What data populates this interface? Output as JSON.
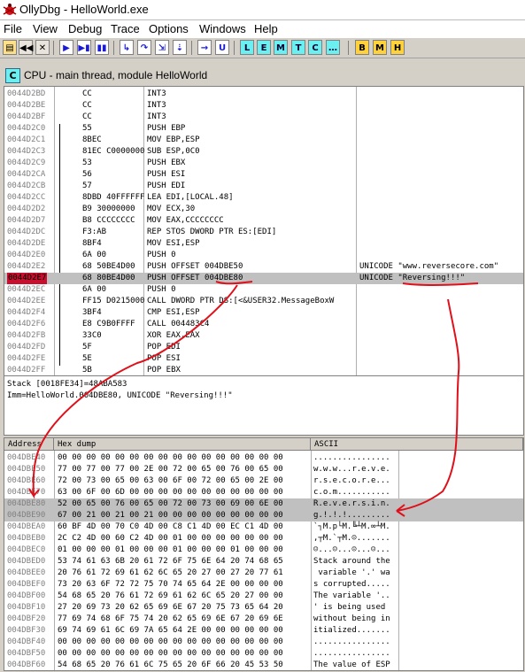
{
  "window": {
    "title": "OllyDbg - HelloWorld.exe"
  },
  "menu": [
    "File",
    "View",
    "Debug",
    "Trace",
    "Options",
    "Windows",
    "Help"
  ],
  "toolbar": {
    "buttons": [
      {
        "name": "open",
        "label": "▤"
      },
      {
        "name": "restart",
        "label": "◀◀"
      },
      {
        "name": "close",
        "label": "✕"
      },
      {
        "name": "run",
        "label": "▶"
      },
      {
        "name": "run-thread",
        "label": "▶▮"
      },
      {
        "name": "pause",
        "label": "▮▮"
      },
      {
        "name": "step-into",
        "label": "↳"
      },
      {
        "name": "step-over",
        "label": "↷"
      },
      {
        "name": "animate-into",
        "label": "⇲"
      },
      {
        "name": "animate-over",
        "label": "⇣"
      },
      {
        "name": "execute-till-return",
        "label": "→"
      },
      {
        "name": "go-to",
        "label": "U"
      },
      {
        "name": "log",
        "label": "L"
      },
      {
        "name": "executable-modules",
        "label": "E"
      },
      {
        "name": "memory-map",
        "label": "M"
      },
      {
        "name": "threads",
        "label": "T"
      },
      {
        "name": "cpu",
        "label": "C"
      },
      {
        "name": "more",
        "label": "…"
      },
      {
        "name": "breakpoints",
        "label": "B"
      },
      {
        "name": "memory-breakpoints",
        "label": "M"
      },
      {
        "name": "hardware-breakpoints",
        "label": "H"
      }
    ]
  },
  "cpu_title": "CPU - main thread, module HelloWorld",
  "disasm": [
    {
      "addr": "0044D2BD",
      "hex": "CC",
      "asm": "INT3",
      "comment": ""
    },
    {
      "addr": "0044D2BE",
      "hex": "CC",
      "asm": "INT3",
      "comment": ""
    },
    {
      "addr": "0044D2BF",
      "hex": "CC",
      "asm": "INT3",
      "comment": ""
    },
    {
      "addr": "0044D2C0",
      "hex": "55",
      "asm": "PUSH EBP",
      "comment": ""
    },
    {
      "addr": "0044D2C1",
      "hex": "8BEC",
      "asm": "MOV EBP,ESP",
      "comment": ""
    },
    {
      "addr": "0044D2C3",
      "hex": "81EC C0000000",
      "asm": "SUB ESP,0C0",
      "comment": ""
    },
    {
      "addr": "0044D2C9",
      "hex": "53",
      "asm": "PUSH EBX",
      "comment": ""
    },
    {
      "addr": "0044D2CA",
      "hex": "56",
      "asm": "PUSH ESI",
      "comment": ""
    },
    {
      "addr": "0044D2CB",
      "hex": "57",
      "asm": "PUSH EDI",
      "comment": ""
    },
    {
      "addr": "0044D2CC",
      "hex": "8DBD 40FFFFFF",
      "asm": "LEA EDI,[LOCAL.48]",
      "comment": ""
    },
    {
      "addr": "0044D2D2",
      "hex": "B9 30000000",
      "asm": "MOV ECX,30",
      "comment": ""
    },
    {
      "addr": "0044D2D7",
      "hex": "B8 CCCCCCCC",
      "asm": "MOV EAX,CCCCCCCC",
      "comment": ""
    },
    {
      "addr": "0044D2DC",
      "hex": "F3:AB",
      "asm": "REP STOS DWORD PTR ES:[EDI]",
      "comment": ""
    },
    {
      "addr": "0044D2DE",
      "hex": "8BF4",
      "asm": "MOV ESI,ESP",
      "comment": ""
    },
    {
      "addr": "0044D2E0",
      "hex": "6A 00",
      "asm": "PUSH 0",
      "comment": ""
    },
    {
      "addr": "0044D2E2",
      "hex": "68 50BE4D00",
      "asm": "PUSH OFFSET 004DBE50",
      "comment": "UNICODE \"www.reversecore.com\""
    },
    {
      "addr": "0044D2E7",
      "hex": "68 80BE4D00",
      "asm": "PUSH OFFSET 004DBE80",
      "comment": "UNICODE \"Reversing!!!\""
    },
    {
      "addr": "0044D2EC",
      "hex": "6A 00",
      "asm": "PUSH 0",
      "comment": ""
    },
    {
      "addr": "0044D2EE",
      "hex": "FF15 D0215000",
      "asm": "CALL DWORD PTR DS:[<&USER32.MessageBoxW",
      "comment": ""
    },
    {
      "addr": "0044D2F4",
      "hex": "3BF4",
      "asm": "CMP ESI,ESP",
      "comment": ""
    },
    {
      "addr": "0044D2F6",
      "hex": "E8 C9B0FFFF",
      "asm": "CALL 004483C4",
      "comment": ""
    },
    {
      "addr": "0044D2FB",
      "hex": "33C0",
      "asm": "XOR EAX,EAX",
      "comment": ""
    },
    {
      "addr": "0044D2FD",
      "hex": "5F",
      "asm": "POP EDI",
      "comment": ""
    },
    {
      "addr": "0044D2FE",
      "hex": "5E",
      "asm": "POP ESI",
      "comment": ""
    },
    {
      "addr": "0044D2FF",
      "hex": "5B",
      "asm": "POP EBX",
      "comment": ""
    }
  ],
  "selected_row": 16,
  "info": {
    "line1": "Stack [0018FE34]=48ABA583",
    "line2": "Imm=HelloWorld.004DBE80, UNICODE \"Reversing!!!\""
  },
  "dump_headers": {
    "address": "Address",
    "hex": "Hex dump",
    "ascii": "ASCII"
  },
  "dump": [
    {
      "addr": "004DBE40",
      "hex": "00 00 00 00 00 00 00 00 00 00 00 00 00 00 00 00",
      "ascii": "................"
    },
    {
      "addr": "004DBE50",
      "hex": "77 00 77 00 77 00 2E 00 72 00 65 00 76 00 65 00",
      "ascii": "w.w.w...r.e.v.e."
    },
    {
      "addr": "004DBE60",
      "hex": "72 00 73 00 65 00 63 00 6F 00 72 00 65 00 2E 00",
      "ascii": "r.s.e.c.o.r.e..."
    },
    {
      "addr": "004DBE70",
      "hex": "63 00 6F 00 6D 00 00 00 00 00 00 00 00 00 00 00",
      "ascii": "c.o.m..........."
    },
    {
      "addr": "004DBE80",
      "hex": "52 00 65 00 76 00 65 00 72 00 73 00 69 00 6E 00",
      "ascii": "R.e.v.e.r.s.i.n."
    },
    {
      "addr": "004DBE90",
      "hex": "67 00 21 00 21 00 21 00 00 00 00 00 00 00 00 00",
      "ascii": "g.!.!.!........."
    },
    {
      "addr": "004DBEA0",
      "hex": "60 BF 4D 00 70 C0 4D 00 C8 C1 4D 00 EC C1 4D 00",
      "ascii": "`┐M.p└M.╚┴M.∞┴M."
    },
    {
      "addr": "004DBEB0",
      "hex": "2C C2 4D 00 60 C2 4D 00 01 00 00 00 00 00 00 00",
      "ascii": ",┬M.`┬M.☺......."
    },
    {
      "addr": "004DBEC0",
      "hex": "01 00 00 00 01 00 00 00 01 00 00 00 01 00 00 00",
      "ascii": "☺...☺...☺...☺..."
    },
    {
      "addr": "004DBED0",
      "hex": "53 74 61 63 6B 20 61 72 6F 75 6E 64 20 74 68 65",
      "ascii": "Stack around the"
    },
    {
      "addr": "004DBEE0",
      "hex": "20 76 61 72 69 61 62 6C 65 20 27 00 27 20 77 61",
      "ascii": " variable '.' wa"
    },
    {
      "addr": "004DBEF0",
      "hex": "73 20 63 6F 72 72 75 70 74 65 64 2E 00 00 00 00",
      "ascii": "s corrupted....."
    },
    {
      "addr": "004DBF00",
      "hex": "54 68 65 20 76 61 72 69 61 62 6C 65 20 27 00 00",
      "ascii": "The variable '.."
    },
    {
      "addr": "004DBF10",
      "hex": "27 20 69 73 20 62 65 69 6E 67 20 75 73 65 64 20",
      "ascii": "' is being used "
    },
    {
      "addr": "004DBF20",
      "hex": "77 69 74 68 6F 75 74 20 62 65 69 6E 67 20 69 6E",
      "ascii": "without being in"
    },
    {
      "addr": "004DBF30",
      "hex": "69 74 69 61 6C 69 7A 65 64 2E 00 00 00 00 00 00",
      "ascii": "itialized......."
    },
    {
      "addr": "004DBF40",
      "hex": "00 00 00 00 00 00 00 00 00 00 00 00 00 00 00 00",
      "ascii": "................"
    },
    {
      "addr": "004DBF50",
      "hex": "00 00 00 00 00 00 00 00 00 00 00 00 00 00 00 00",
      "ascii": "................"
    },
    {
      "addr": "004DBF60",
      "hex": "54 68 65 20 76 61 6C 75 65 20 6F 66 20 45 53 50",
      "ascii": "The value of ESP"
    }
  ],
  "dump_highlight_rows": [
    4,
    5
  ],
  "colors": {
    "selection": "#c0c0c0",
    "selected_address": "#c8102e",
    "annotation": "#e0101a"
  }
}
